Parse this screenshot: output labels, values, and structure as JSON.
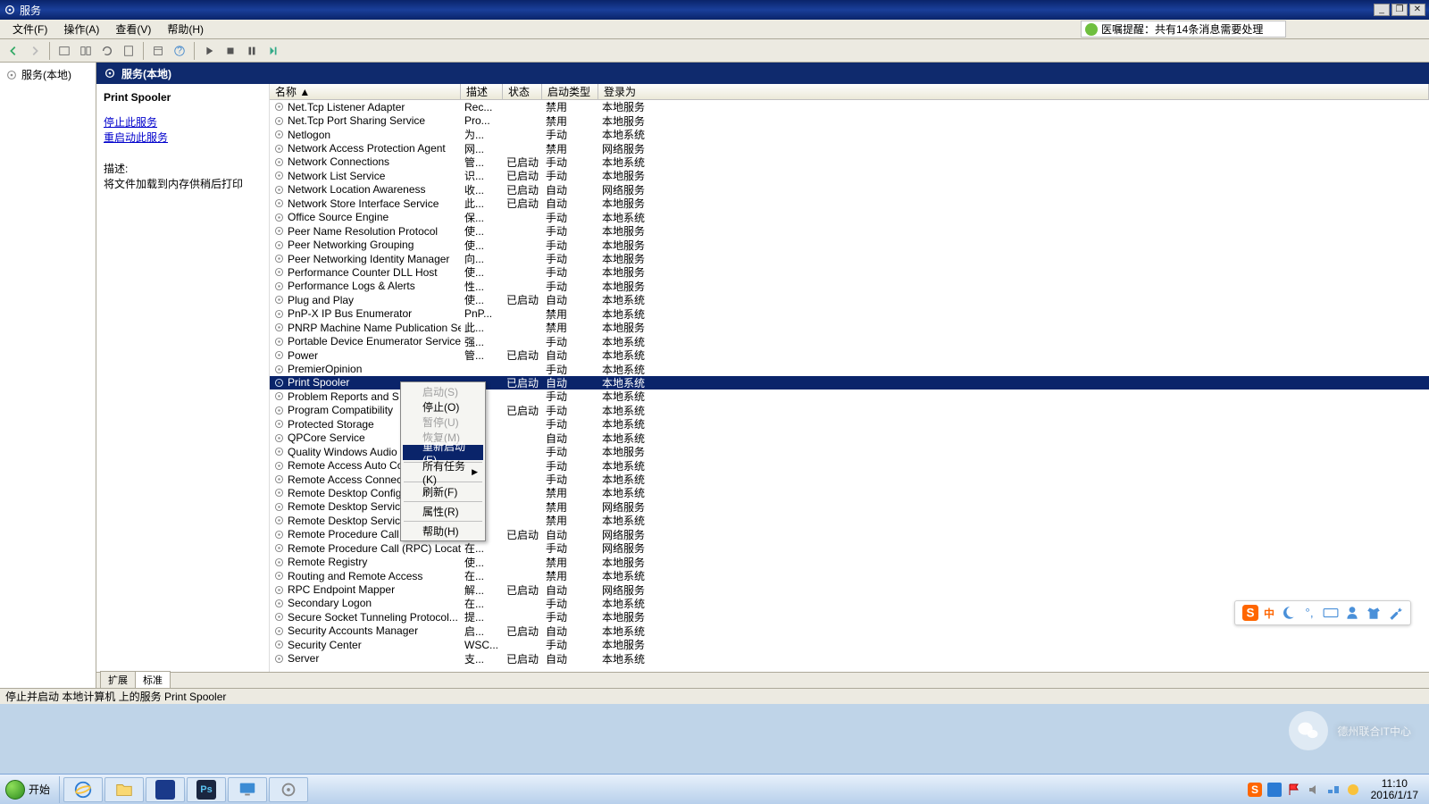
{
  "title": "服务",
  "menus": {
    "file": "文件(F)",
    "action": "操作(A)",
    "view": "查看(V)",
    "help": "帮助(H)"
  },
  "notice": "医嘱提醒：共有14条消息需要处理",
  "tree": {
    "root": "服务(本地)"
  },
  "contentHeader": "服务(本地)",
  "detail": {
    "name": "Print Spooler",
    "stopLink": "停止此服务",
    "restartLink": "重启动此服务",
    "descLabel": "描述:",
    "desc": "将文件加载到内存供稍后打印"
  },
  "columns": {
    "name": "名称 ▲",
    "desc": "描述",
    "status": "状态",
    "stype": "启动类型",
    "logon": "登录为"
  },
  "rows": [
    {
      "n": "Net.Tcp Listener Adapter",
      "d": "Rec...",
      "s": "",
      "t": "禁用",
      "l": "本地服务"
    },
    {
      "n": "Net.Tcp Port Sharing Service",
      "d": "Pro...",
      "s": "",
      "t": "禁用",
      "l": "本地服务"
    },
    {
      "n": "Netlogon",
      "d": "为...",
      "s": "",
      "t": "手动",
      "l": "本地系统"
    },
    {
      "n": "Network Access Protection Agent",
      "d": "网...",
      "s": "",
      "t": "禁用",
      "l": "网络服务"
    },
    {
      "n": "Network Connections",
      "d": "管...",
      "s": "已启动",
      "t": "手动",
      "l": "本地系统"
    },
    {
      "n": "Network List Service",
      "d": "识...",
      "s": "已启动",
      "t": "手动",
      "l": "本地服务"
    },
    {
      "n": "Network Location Awareness",
      "d": "收...",
      "s": "已启动",
      "t": "自动",
      "l": "网络服务"
    },
    {
      "n": "Network Store Interface Service",
      "d": "此...",
      "s": "已启动",
      "t": "自动",
      "l": "本地服务"
    },
    {
      "n": "Office Source Engine",
      "d": "保...",
      "s": "",
      "t": "手动",
      "l": "本地系统"
    },
    {
      "n": "Peer Name Resolution Protocol",
      "d": "使...",
      "s": "",
      "t": "手动",
      "l": "本地服务"
    },
    {
      "n": "Peer Networking Grouping",
      "d": "使...",
      "s": "",
      "t": "手动",
      "l": "本地服务"
    },
    {
      "n": "Peer Networking Identity Manager",
      "d": "向...",
      "s": "",
      "t": "手动",
      "l": "本地服务"
    },
    {
      "n": "Performance Counter DLL Host",
      "d": "使...",
      "s": "",
      "t": "手动",
      "l": "本地服务"
    },
    {
      "n": "Performance Logs & Alerts",
      "d": "性...",
      "s": "",
      "t": "手动",
      "l": "本地服务"
    },
    {
      "n": "Plug and Play",
      "d": "使...",
      "s": "已启动",
      "t": "自动",
      "l": "本地系统"
    },
    {
      "n": "PnP-X IP Bus Enumerator",
      "d": "PnP...",
      "s": "",
      "t": "禁用",
      "l": "本地系统"
    },
    {
      "n": "PNRP Machine Name Publication Se...",
      "d": "此...",
      "s": "",
      "t": "禁用",
      "l": "本地服务"
    },
    {
      "n": "Portable Device Enumerator Service",
      "d": "强...",
      "s": "",
      "t": "手动",
      "l": "本地系统"
    },
    {
      "n": "Power",
      "d": "管...",
      "s": "已启动",
      "t": "自动",
      "l": "本地系统"
    },
    {
      "n": "PremierOpinion",
      "d": "",
      "s": "",
      "t": "手动",
      "l": "本地系统"
    },
    {
      "n": "Print Spooler",
      "d": "",
      "s": "已启动",
      "t": "自动",
      "l": "本地系统",
      "sel": true
    },
    {
      "n": "Problem Reports and S",
      "d": "",
      "s": "",
      "t": "手动",
      "l": "本地系统"
    },
    {
      "n": "Program Compatibility",
      "d": "",
      "s": "已启动",
      "t": "手动",
      "l": "本地系统"
    },
    {
      "n": "Protected Storage",
      "d": "",
      "s": "",
      "t": "手动",
      "l": "本地系统"
    },
    {
      "n": "QPCore Service",
      "d": "",
      "s": "",
      "t": "自动",
      "l": "本地系统"
    },
    {
      "n": "Quality Windows Audio",
      "d": "",
      "s": "",
      "t": "手动",
      "l": "本地服务"
    },
    {
      "n": "Remote Access Auto Co",
      "d": "",
      "s": "",
      "t": "手动",
      "l": "本地系统"
    },
    {
      "n": "Remote Access Connect",
      "d": "",
      "s": "",
      "t": "手动",
      "l": "本地系统"
    },
    {
      "n": "Remote Desktop Config",
      "d": "",
      "s": "",
      "t": "禁用",
      "l": "本地系统"
    },
    {
      "n": "Remote Desktop Servic",
      "d": "",
      "s": "",
      "t": "禁用",
      "l": "网络服务"
    },
    {
      "n": "Remote Desktop Servic",
      "d": "",
      "s": "",
      "t": "禁用",
      "l": "本地系统"
    },
    {
      "n": "Remote Procedure Call",
      "d": "",
      "s": "已启动",
      "t": "自动",
      "l": "网络服务"
    },
    {
      "n": "Remote Procedure Call (RPC) Locator",
      "d": "在...",
      "s": "",
      "t": "手动",
      "l": "网络服务"
    },
    {
      "n": "Remote Registry",
      "d": "使...",
      "s": "",
      "t": "禁用",
      "l": "本地服务"
    },
    {
      "n": "Routing and Remote Access",
      "d": "在...",
      "s": "",
      "t": "禁用",
      "l": "本地系统"
    },
    {
      "n": "RPC Endpoint Mapper",
      "d": "解...",
      "s": "已启动",
      "t": "自动",
      "l": "网络服务"
    },
    {
      "n": "Secondary Logon",
      "d": "在...",
      "s": "",
      "t": "手动",
      "l": "本地系统"
    },
    {
      "n": "Secure Socket Tunneling Protocol...",
      "d": "提...",
      "s": "",
      "t": "手动",
      "l": "本地服务"
    },
    {
      "n": "Security Accounts Manager",
      "d": "启...",
      "s": "已启动",
      "t": "自动",
      "l": "本地系统"
    },
    {
      "n": "Security Center",
      "d": "WSC...",
      "s": "",
      "t": "手动",
      "l": "本地服务"
    },
    {
      "n": "Server",
      "d": "支...",
      "s": "已启动",
      "t": "自动",
      "l": "本地系统"
    }
  ],
  "context": [
    {
      "label": "启动(S)",
      "disabled": true
    },
    {
      "label": "停止(O)"
    },
    {
      "label": "暂停(U)",
      "disabled": true
    },
    {
      "label": "恢复(M)",
      "disabled": true
    },
    {
      "label": "重新启动(E)",
      "hl": true
    },
    {
      "sep": true
    },
    {
      "label": "所有任务(K)",
      "sub": true
    },
    {
      "sep": true
    },
    {
      "label": "刷新(F)"
    },
    {
      "sep": true
    },
    {
      "label": "属性(R)"
    },
    {
      "sep": true
    },
    {
      "label": "帮助(H)"
    }
  ],
  "tabs": {
    "ext": "扩展",
    "std": "标准"
  },
  "status": "停止并启动 本地计算机 上的服务 Print Spooler",
  "start": "开始",
  "imeText": "中",
  "clock": {
    "time": "11:10",
    "date": "2016/1/17"
  },
  "watermark": "德州联合IT中心"
}
